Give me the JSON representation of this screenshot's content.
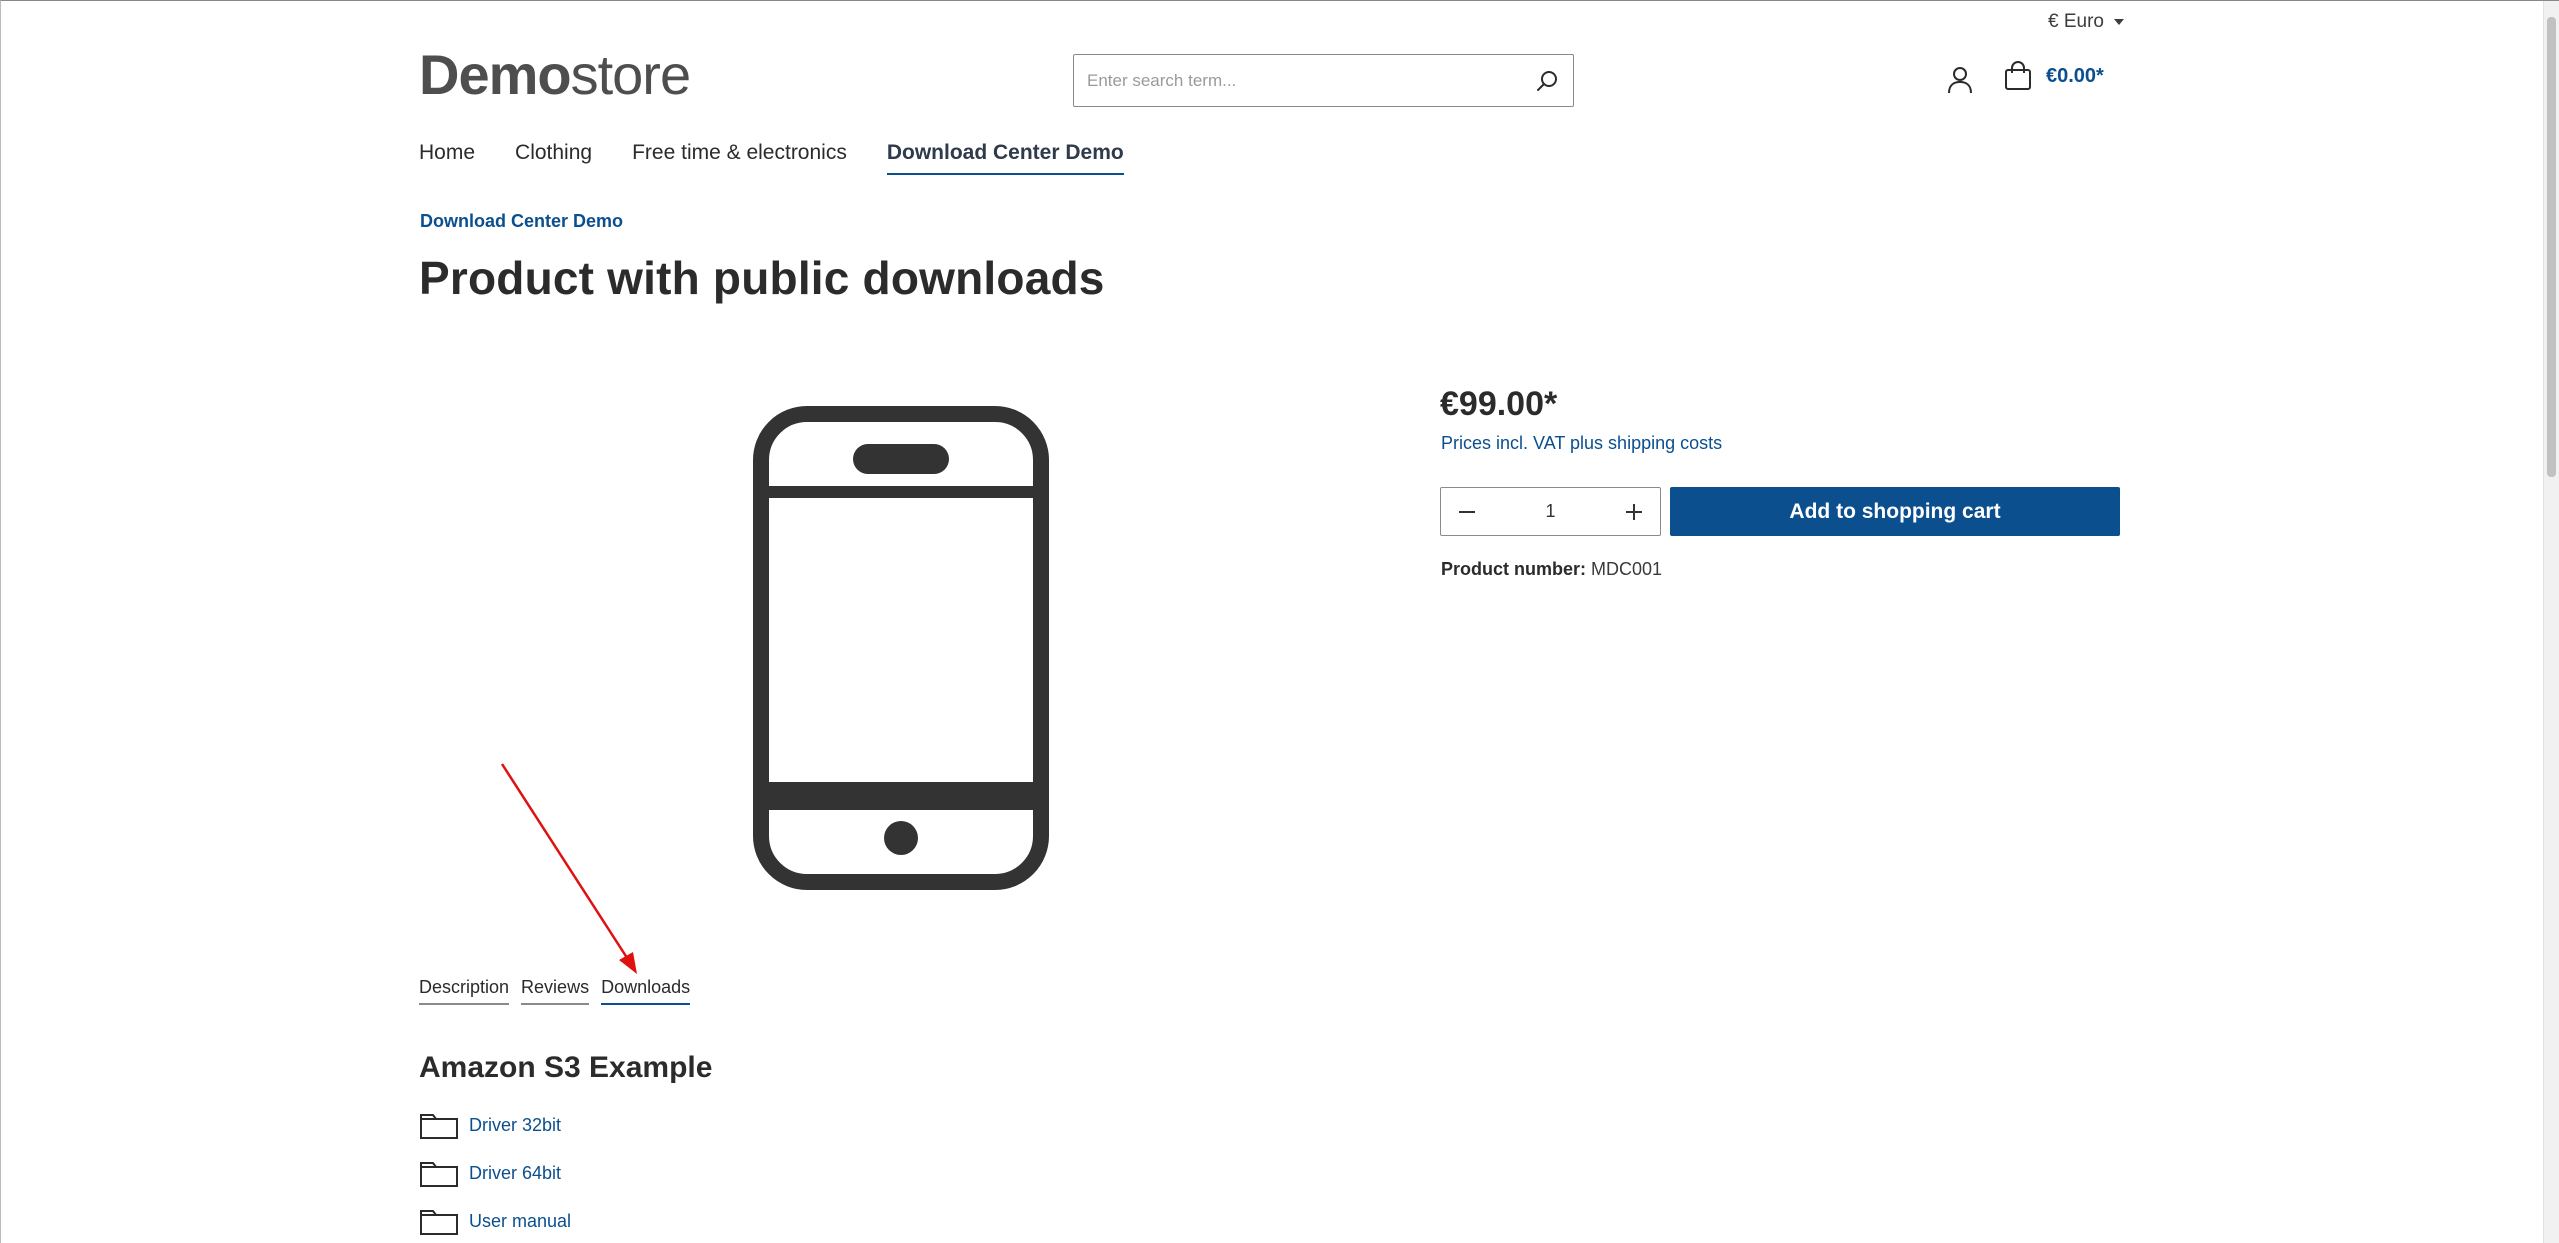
{
  "header": {
    "currency": "€ Euro",
    "logo_bold": "Demo",
    "logo_light": "store",
    "search_placeholder": "Enter search term...",
    "cart_total": "€0.00*"
  },
  "nav": {
    "items": [
      "Home",
      "Clothing",
      "Free time & electronics",
      "Download Center Demo"
    ],
    "active_index": 3
  },
  "product": {
    "breadcrumb": "Download Center Demo",
    "title": "Product with public downloads",
    "price": "€99.00*",
    "tax_note": "Prices incl. VAT plus shipping costs",
    "quantity": "1",
    "add_to_cart_label": "Add to shopping cart",
    "product_number_label": "Product number:",
    "product_number": "MDC001"
  },
  "tabs": {
    "items": [
      "Description",
      "Reviews",
      "Downloads"
    ],
    "active_index": 2
  },
  "downloads": {
    "heading": "Amazon S3 Example",
    "items": [
      "Driver 32bit",
      "Driver 64bit",
      "User manual"
    ]
  },
  "colors": {
    "accent": "#0b4f8f",
    "text": "#2b2b2b",
    "annotation_arrow": "#e01010"
  },
  "icons": {
    "search": "search-icon",
    "account": "user-icon",
    "cart": "shopping-bag-icon",
    "folder": "folder-icon"
  }
}
